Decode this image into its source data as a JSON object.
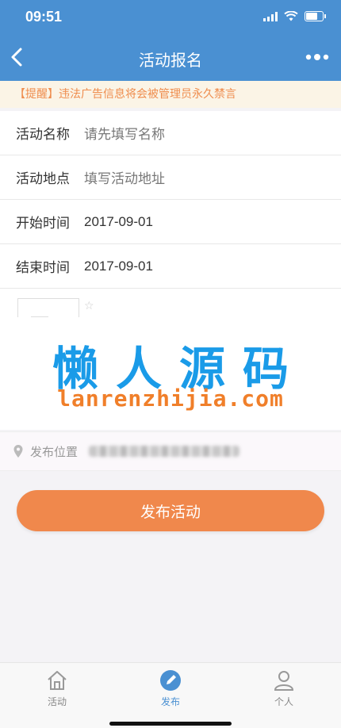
{
  "status_bar": {
    "time": "09:51"
  },
  "nav": {
    "title": "活动报名",
    "back_icon": "chevron-left-icon",
    "more_icon": "more-dots-icon"
  },
  "notice": {
    "text": "【提醒】违法广告信息将会被管理员永久禁言"
  },
  "form": {
    "rows": [
      {
        "label": "活动名称",
        "value": "请先填写名称"
      },
      {
        "label": "活动地点",
        "value": "填写活动地址"
      },
      {
        "label": "开始时间",
        "value": "2017-09-01"
      },
      {
        "label": "结束时间",
        "value": "2017-09-01"
      }
    ]
  },
  "watermark": {
    "title": "懒人源码",
    "url": "lanrenzhijia.com"
  },
  "location": {
    "label": "发布位置"
  },
  "submit": {
    "label": "发布活动"
  },
  "tabbar": {
    "items": [
      {
        "label": "活动",
        "icon": "home-icon"
      },
      {
        "label": "发布",
        "icon": "compose-icon"
      },
      {
        "label": "个人",
        "icon": "user-icon"
      }
    ],
    "active": "发布"
  },
  "colors": {
    "primary": "#4a90d2",
    "accent": "#f0884c",
    "notice_text": "#ef8d4e",
    "watermark_cn": "#1a9be8",
    "watermark_en": "#f07f2a"
  }
}
